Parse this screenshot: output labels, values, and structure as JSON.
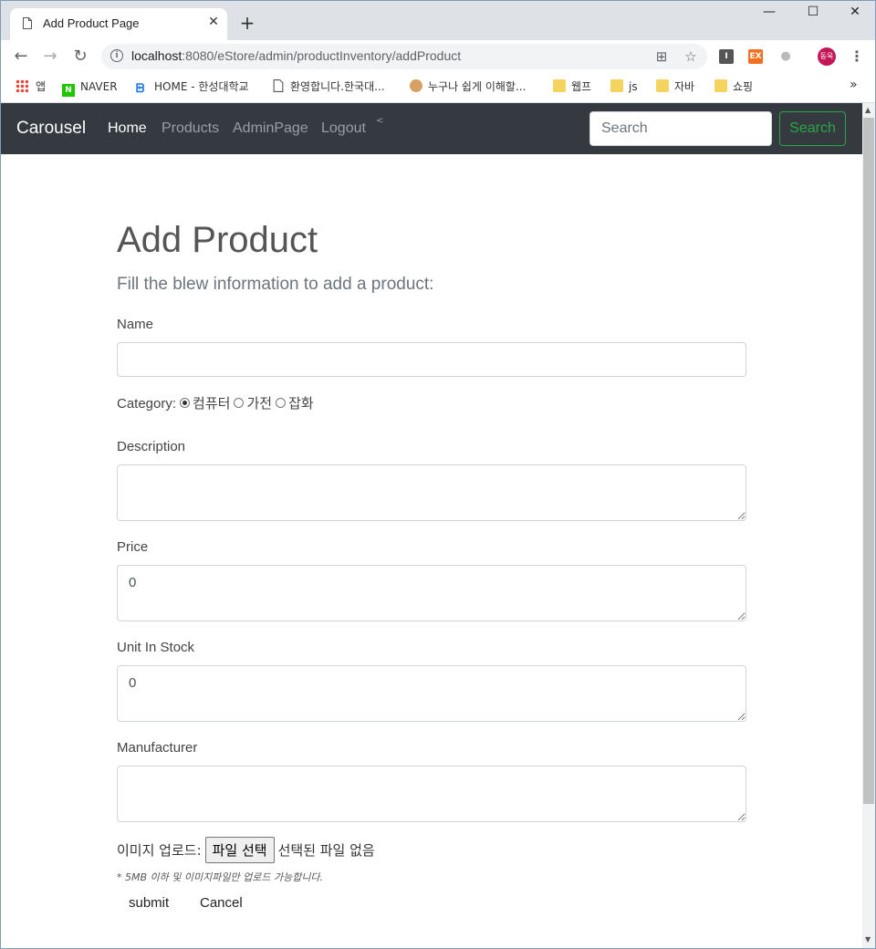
{
  "browser": {
    "tab_title": "Add Product Page",
    "tab_close": "✕",
    "new_tab": "+",
    "window_controls": {
      "minimize": "—",
      "maximize": "☐",
      "close": "✕"
    },
    "url_host": "localhost",
    "url_rest": ":8080/eStore/admin/productInventory/addProduct",
    "extensions": [
      "I",
      "EX"
    ],
    "profile_initials": "동욱",
    "bookmarks": [
      {
        "label": "앱",
        "icon": "apps-icon"
      },
      {
        "label": "NAVER",
        "icon": "naver-icon"
      },
      {
        "label": "HOME - 한성대학교",
        "icon": "hansung-icon"
      },
      {
        "label": "환영합니다.한국대...",
        "icon": "page-icon"
      },
      {
        "label": "누구나 쉽게 이해할...",
        "icon": "site-icon"
      },
      {
        "label": "웹프",
        "icon": "folder-icon"
      },
      {
        "label": "js",
        "icon": "folder-icon"
      },
      {
        "label": "자바",
        "icon": "folder-icon"
      },
      {
        "label": "쇼핑",
        "icon": "folder-icon"
      }
    ],
    "bookmarks_more": "»"
  },
  "navbar": {
    "brand": "Carousel",
    "links": [
      "Home",
      "Products",
      "AdminPage",
      "Logout"
    ],
    "caret": "<",
    "search_placeholder": "Search",
    "search_button": "Search"
  },
  "form": {
    "title": "Add Product",
    "subtitle": "Fill the blew information to add a product:",
    "name_label": "Name",
    "name_value": "",
    "category_label": "Category:",
    "categories": [
      "컴퓨터",
      "가전",
      "잡화"
    ],
    "selected_category": "컴퓨터",
    "description_label": "Description",
    "description_value": "",
    "price_label": "Price",
    "price_value": "0",
    "stock_label": "Unit In Stock",
    "stock_value": "0",
    "manufacturer_label": "Manufacturer",
    "manufacturer_value": "",
    "upload_label": "이미지 업로드:",
    "file_button": "파일 선택",
    "file_status": "선택된 파일 없음",
    "upload_note": "* 5MB 이하 및 이미지파일만 업로드 가능합니다.",
    "submit_label": "submit",
    "cancel_label": "Cancel"
  }
}
